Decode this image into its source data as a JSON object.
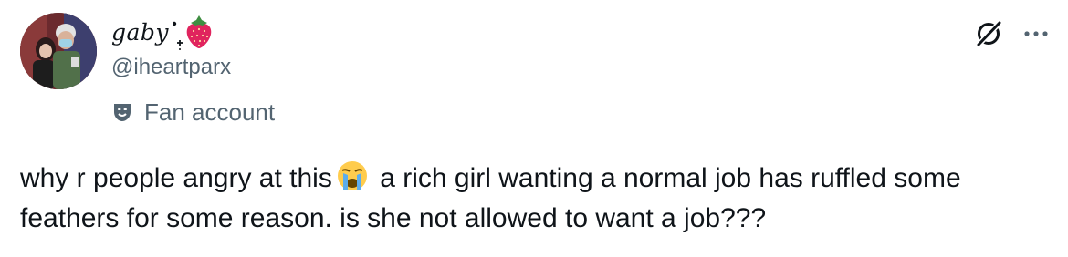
{
  "author": {
    "display_name": "gaby",
    "handle": "@iheartparx",
    "label": "Fan account",
    "avatar_alt": "profile-photo",
    "decoration_icons": [
      "sparkle-dots-icon",
      "strawberry-icon"
    ]
  },
  "actions": {
    "grok_icon": "grok-icon",
    "more_icon": "more-icon"
  },
  "post": {
    "text_part1": "why r people angry at this",
    "emoji": "loudly-crying-face-icon",
    "text_part2": " a rich girl wanting a normal job has ruffled some feathers for some reason. is she not allowed to want a job???"
  },
  "colors": {
    "primary_text": "#0f1419",
    "secondary_text": "#536471",
    "strawberry": "#e0245e",
    "emoji_face": "#ffcc4d",
    "emoji_tears": "#5dadec"
  }
}
